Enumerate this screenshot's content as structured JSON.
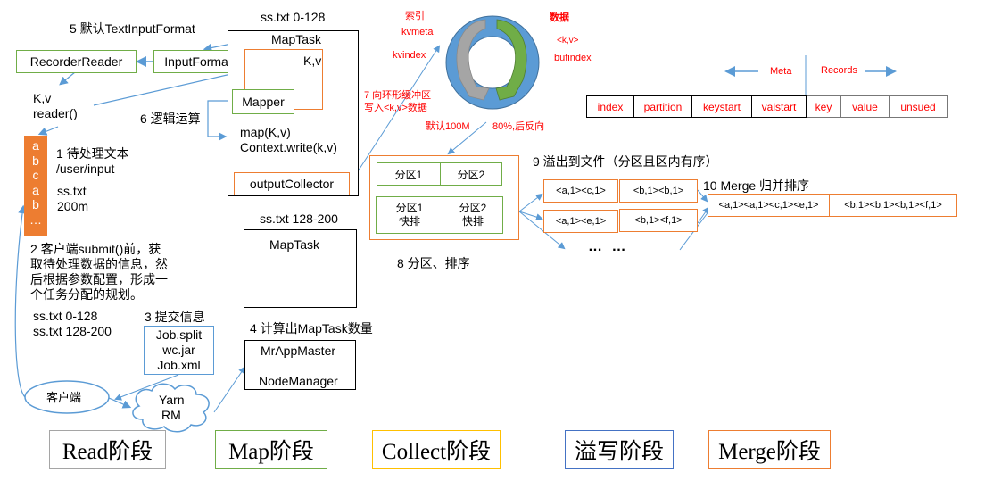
{
  "read_section": {
    "step5_label": "5 默认TextInputFormat",
    "recorder_reader": "RecorderReader",
    "input_format": "InputFormat",
    "kv_label": "K,v",
    "reader_label": "reader()",
    "file_chars": [
      "a",
      "b",
      "c",
      "a",
      "b",
      "…"
    ],
    "step1_title": "1 待处理文本",
    "step1_path": "/user/input",
    "step1_file": "ss.txt",
    "step1_size": "200m",
    "step2_lines": [
      "2 客户端submit()前，获",
      "取待处理数据的信息，然",
      "后根据参数配置，形成一",
      "个任务分配的规划。"
    ],
    "split_lines": [
      "ss.txt  0-128",
      "ss.txt  128-200"
    ],
    "step3_title": "3 提交信息",
    "job_files": [
      "Job.split",
      "wc.jar",
      "Job.xml"
    ],
    "client_label": "客户端",
    "yarn_lines": [
      "Yarn",
      "RM"
    ],
    "step4_title": "4 计算出MapTask数量",
    "app_master": "MrAppMaster",
    "node_manager": "NodeManager"
  },
  "map_section": {
    "split1_label": "ss.txt 0-128",
    "maptask_label": "MapTask",
    "kv_label": "K,v",
    "mapper_label": "Mapper",
    "step6_label": "6 逻辑运算",
    "map_call": "map(K,v)",
    "context_write": "Context.write(k,v)",
    "output_collector": "outputCollector",
    "split2_label": "ss.txt 128-200",
    "maptask2_label": "MapTask"
  },
  "buffer_section": {
    "index_label": "索引",
    "kvmeta_label": "kvmeta",
    "kvindex_label": "kvindex",
    "data_label": "数据",
    "kv_angle": "<k,v>",
    "bufindex_label": "bufindex",
    "step7_lines": [
      "7 向环形缓冲区",
      "写入<k,v>数据"
    ],
    "default_size": "默认100M",
    "reverse_label": "80%,后反向",
    "meta_label": "Meta",
    "records_label": "Records",
    "meta_cells": [
      "index",
      "partition",
      "keystart",
      "valstart"
    ],
    "record_cells": [
      "key",
      "value",
      "unsued"
    ],
    "colors": {
      "ring": "#5b9bd5",
      "gray_arrow": "#a5a5a5",
      "green_arrow": "#70ad47",
      "annotation": "#ff0000"
    }
  },
  "sort_section": {
    "partitions_top": [
      "分区1",
      "分区2"
    ],
    "partitions_bottom": [
      [
        "分区1",
        "快排"
      ],
      [
        "分区2",
        "快排"
      ]
    ],
    "step8_label": "8 分区、排序",
    "step9_label": "9 溢出到文件（分区且区内有序）",
    "spill_rows": [
      [
        "<a,1><c,1>",
        "<b,1><b,1>"
      ],
      [
        "<a,1><e,1>",
        "<b,1><f,1>"
      ]
    ],
    "ellipsis": "… …",
    "step10_label": "10 Merge 归并排序",
    "merged": [
      "<a,1><a,1><c,1><e,1>",
      "<b,1><b,1><b,1><f,1>"
    ]
  },
  "stages": [
    {
      "label": "Read阶段",
      "color": "#a5a5a5"
    },
    {
      "label": "Map阶段",
      "color": "#70ad47"
    },
    {
      "label": "Collect阶段",
      "color": "#ffc000"
    },
    {
      "label": "溢写阶段",
      "color": "#4472c4"
    },
    {
      "label": "Merge阶段",
      "color": "#ed7d31"
    }
  ]
}
